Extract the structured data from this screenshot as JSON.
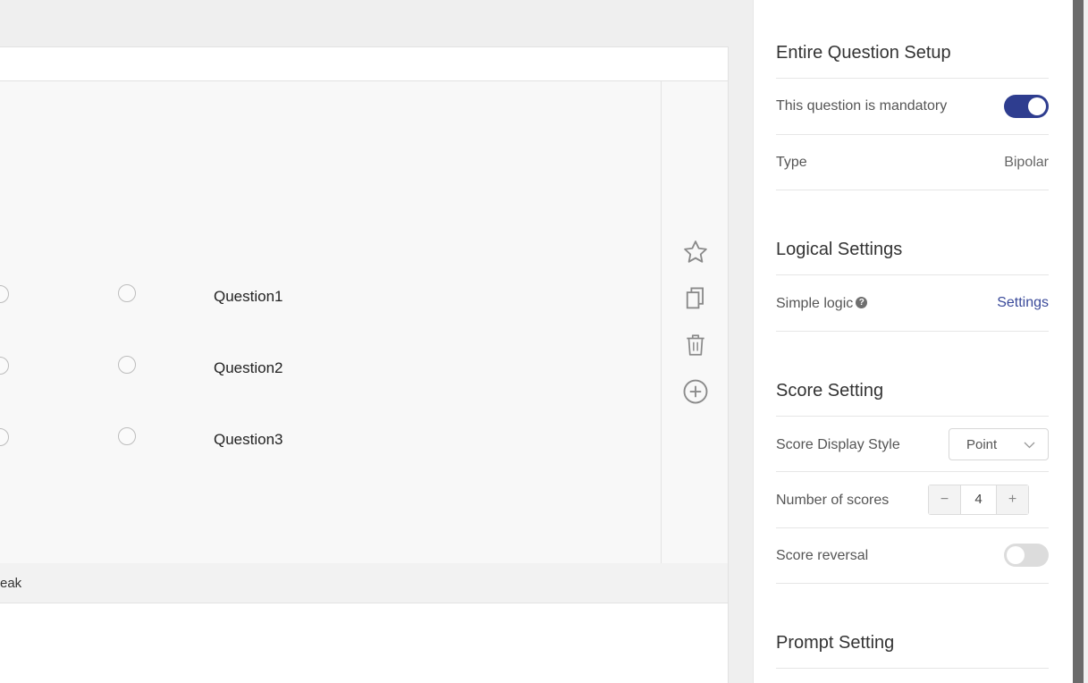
{
  "editor": {
    "questions": [
      {
        "label": "Question1"
      },
      {
        "label": "Question2"
      },
      {
        "label": "Question3"
      }
    ],
    "tools": [
      "star-icon",
      "copy-icon",
      "trash-icon",
      "add-circle-icon"
    ],
    "bottom_bar_text": "eak"
  },
  "panel": {
    "entire_setup": {
      "title": "Entire Question Setup",
      "mandatory_label": "This question is mandatory",
      "mandatory_on": true,
      "type_label": "Type",
      "type_value": "Bipolar"
    },
    "logical": {
      "title": "Logical Settings",
      "simple_logic_label": "Simple logic",
      "help_glyph": "?",
      "settings_link": "Settings"
    },
    "score": {
      "title": "Score Setting",
      "display_style_label": "Score Display Style",
      "display_style_value": "Point",
      "num_scores_label": "Number of scores",
      "num_scores_value": "4",
      "minus": "−",
      "plus": "+",
      "reversal_label": "Score reversal",
      "reversal_on": false
    },
    "prompt": {
      "title": "Prompt Setting"
    }
  },
  "colors": {
    "accent": "#2e3d8f",
    "link": "#3a4a9a"
  }
}
